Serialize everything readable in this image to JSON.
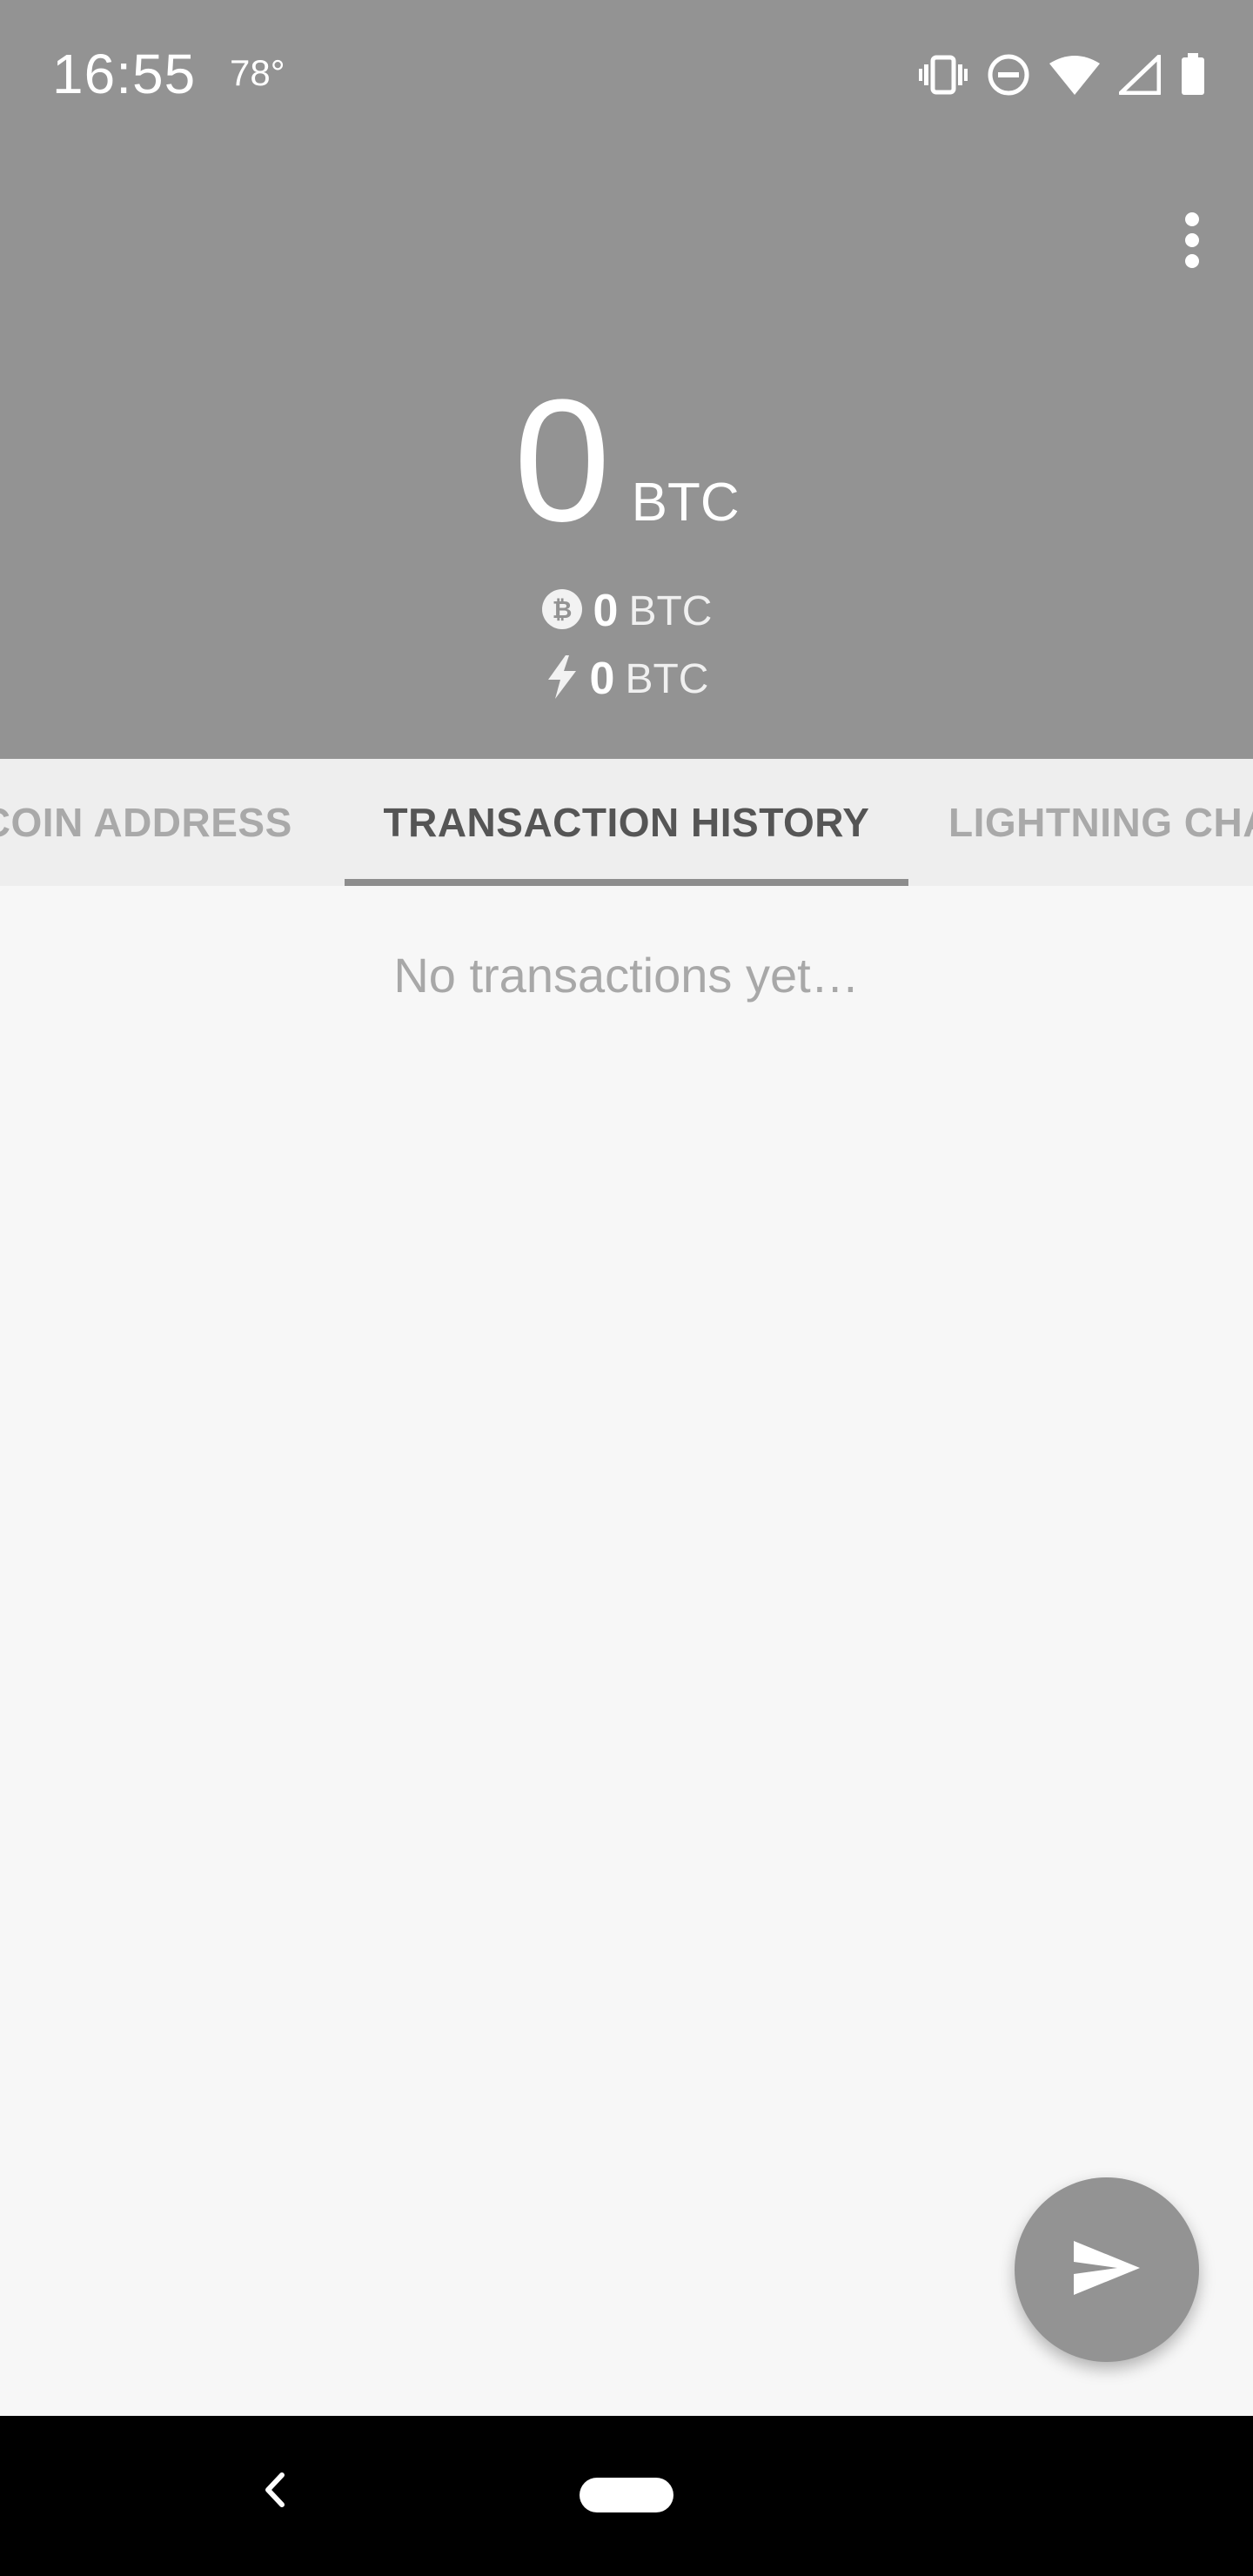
{
  "status_bar": {
    "time": "16:55",
    "temperature": "78°",
    "icons": [
      "vibrate-icon",
      "do-not-disturb-icon",
      "wifi-icon",
      "cell-signal-icon",
      "battery-icon"
    ]
  },
  "header": {
    "menu_icon": "more-vert-icon",
    "balance": {
      "amount": "0",
      "unit": "BTC"
    },
    "onchain": {
      "icon": "bitcoin-icon",
      "amount": "0",
      "unit": "BTC"
    },
    "lightning": {
      "icon": "lightning-icon",
      "amount": "0",
      "unit": "BTC"
    }
  },
  "tabs": [
    {
      "label": "TCOIN ADDRESS",
      "selected": false
    },
    {
      "label": "TRANSACTION HISTORY",
      "selected": true
    },
    {
      "label": "LIGHTNING CHA",
      "selected": false
    }
  ],
  "content": {
    "empty_message": "No transactions yet…"
  },
  "fab": {
    "icon": "send-icon"
  },
  "navigation": {
    "back_icon": "back-icon",
    "home_icon": "home-pill-icon"
  },
  "colors": {
    "header_bg": "#939393",
    "tab_bg": "#eeeeee",
    "selected_tab_text": "#555555",
    "unselected_tab_text": "#a9a9a9",
    "content_bg": "#f7f7f7",
    "fab_bg": "#939393",
    "navbar_bg": "#000000"
  }
}
